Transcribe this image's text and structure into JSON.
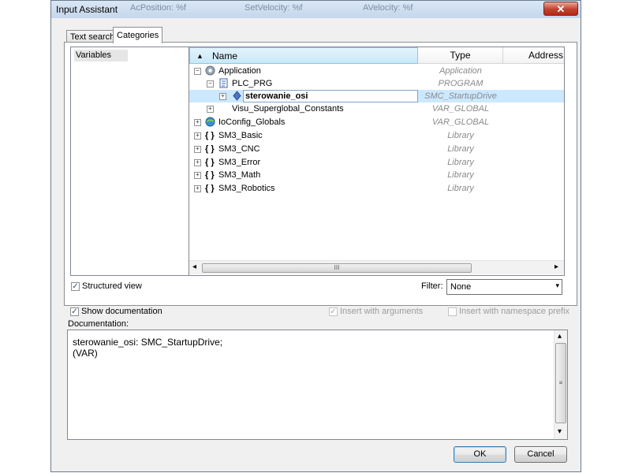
{
  "window": {
    "title": "Input Assistant",
    "ghost_titles": [
      "AcPosition: %f",
      "SetVelocity: %f",
      "AVelocity: %f"
    ],
    "close_glyph": "✕"
  },
  "tabs": [
    {
      "label": "Text search"
    },
    {
      "label": "Categories",
      "active": true
    }
  ],
  "categories": {
    "items": [
      {
        "label": "Variables",
        "selected": true
      }
    ]
  },
  "tree": {
    "columns": {
      "sort_glyph": "▲",
      "name": "Name",
      "type": "Type",
      "address": "Address"
    },
    "rows": [
      {
        "name": "Application",
        "type": "Application",
        "icon": "gear-icon",
        "expander": "−"
      },
      {
        "name": "PLC_PRG",
        "type": "PROGRAM",
        "icon": "program-icon",
        "expander": "−"
      },
      {
        "name": "sterowanie_osi",
        "type": "SMC_StartupDrive",
        "icon": "variable-icon",
        "expander": "+",
        "selected": true
      },
      {
        "name": "Visu_Superglobal_Constants",
        "type": "VAR_GLOBAL",
        "icon": "none",
        "expander": "+"
      },
      {
        "name": "IoConfig_Globals",
        "type": "VAR_GLOBAL",
        "icon": "globe-icon",
        "expander": "+"
      },
      {
        "name": "SM3_Basic",
        "type": "Library",
        "icon": "library-icon",
        "expander": "+"
      },
      {
        "name": "SM3_CNC",
        "type": "Library",
        "icon": "library-icon",
        "expander": "+"
      },
      {
        "name": "SM3_Error",
        "type": "Library",
        "icon": "library-icon",
        "expander": "+"
      },
      {
        "name": "SM3_Math",
        "type": "Library",
        "icon": "library-icon",
        "expander": "+"
      },
      {
        "name": "SM3_Robotics",
        "type": "Library",
        "icon": "library-icon",
        "expander": "+"
      }
    ],
    "library_glyph": "{ }",
    "scroll": {
      "left": "◂",
      "right": "▸",
      "grip": "III"
    }
  },
  "options": {
    "structured_view": {
      "label": "Structured view",
      "checked": true
    },
    "filter": {
      "label": "Filter:",
      "value": "None",
      "arrow": "▾"
    },
    "show_documentation": {
      "label": "Show documentation",
      "checked": true
    },
    "insert_with_arguments": {
      "label": "Insert with arguments",
      "checked": true,
      "disabled": true
    },
    "insert_with_namespace": {
      "label": "Insert with namespace prefix",
      "checked": false,
      "disabled": true
    },
    "check_glyph": "✓"
  },
  "documentation": {
    "label": "Documentation:",
    "text": "sterowanie_osi: SMC_StartupDrive;\n(VAR)",
    "scroll": {
      "up": "▴",
      "down": "▾",
      "grip": "≡"
    }
  },
  "buttons": {
    "ok": "OK",
    "cancel": "Cancel"
  },
  "colors": {
    "selection": "#cce8ff",
    "header_active": "#c8e8f8",
    "close": "#c4402c"
  }
}
